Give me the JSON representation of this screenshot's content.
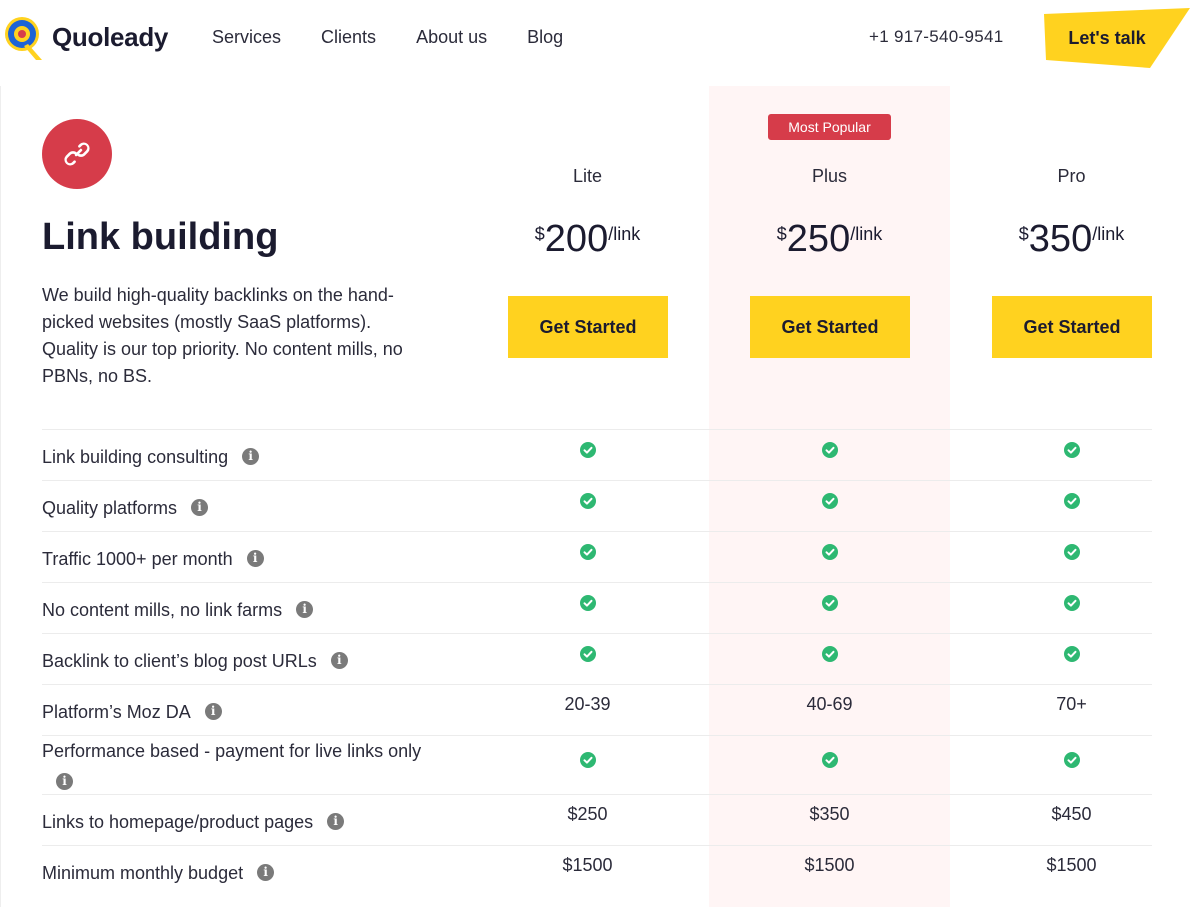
{
  "header": {
    "brand": "Quoleady",
    "nav": [
      "Services",
      "Clients",
      "About us",
      "Blog"
    ],
    "phone": "+1 917-540-9541",
    "cta": "Let's talk"
  },
  "hero": {
    "title": "Link building",
    "description": "We build high-quality backlinks on the hand-picked websites (mostly SaaS platforms). Quality is our top priority. No content mills, no PBNs, no BS."
  },
  "popular_badge": "Most Popular",
  "plans": [
    {
      "name": "Lite",
      "currency": "$",
      "amount": "200",
      "unit": "/link",
      "cta": "Get Started"
    },
    {
      "name": "Plus",
      "currency": "$",
      "amount": "250",
      "unit": "/link",
      "cta": "Get Started"
    },
    {
      "name": "Pro",
      "currency": "$",
      "amount": "350",
      "unit": "/link",
      "cta": "Get Started"
    }
  ],
  "info_glyph": "i",
  "features": [
    {
      "label": "Link building consulting",
      "values": [
        "check",
        "check",
        "check"
      ]
    },
    {
      "label": "Quality platforms",
      "values": [
        "check",
        "check",
        "check"
      ]
    },
    {
      "label": "Traffic 1000+ per month",
      "values": [
        "check",
        "check",
        "check"
      ]
    },
    {
      "label": "No content mills, no link farms",
      "values": [
        "check",
        "check",
        "check"
      ]
    },
    {
      "label": "Backlink to client’s blog post URLs",
      "values": [
        "check",
        "check",
        "check"
      ]
    },
    {
      "label": "Platform’s Moz DA",
      "values": [
        "20-39",
        "40-69",
        "70+"
      ]
    },
    {
      "label": "Performance based - payment for live links only",
      "values": [
        "check",
        "check",
        "check"
      ]
    },
    {
      "label": "Links to homepage/product pages",
      "values": [
        "$250",
        "$350",
        "$450"
      ]
    },
    {
      "label": "Minimum monthly budget",
      "values": [
        "$1500",
        "$1500",
        "$1500"
      ]
    }
  ],
  "colors": {
    "accent_yellow": "#ffd21f",
    "accent_red": "#d63c4a",
    "check_green": "#2eb872",
    "popular_bg": "#fff5f5"
  },
  "icons": {
    "logo": "quoleady-logo-icon",
    "hero": "link-icon",
    "info": "info-icon",
    "check": "check-circle-icon"
  }
}
